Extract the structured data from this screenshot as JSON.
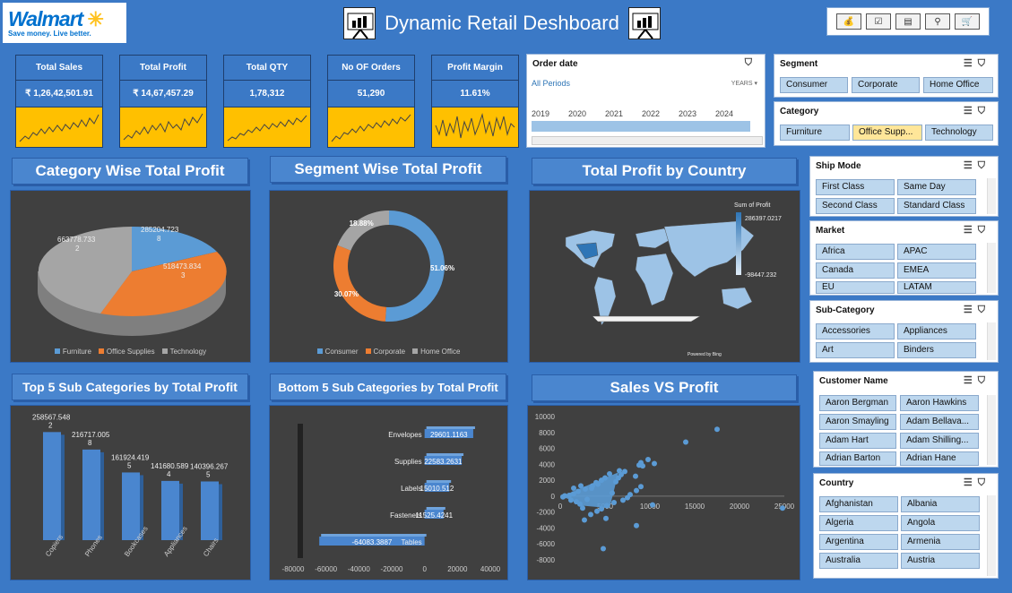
{
  "header": {
    "logo_name": "Walmart",
    "logo_tagline": "Save money. Live better.",
    "title": "Dynamic Retail Deshboard"
  },
  "colors": {
    "background": "#3b79c6",
    "kpi_spark": "#ffc000",
    "furniture": "#5b9bd5",
    "office": "#ed7d31",
    "technology": "#a5a5a5"
  },
  "kpis": [
    {
      "label": "Total Sales",
      "value": "₹ 1,26,42,501.91"
    },
    {
      "label": "Total Profit",
      "value": "₹ 14,67,457.29"
    },
    {
      "label": "Total QTY",
      "value": "1,78,312"
    },
    {
      "label": "No OF Orders",
      "value": "51,290"
    },
    {
      "label": "Profit Margin",
      "value": "11.61%"
    }
  ],
  "order_date": {
    "title": "Order date",
    "period": "All Periods",
    "unit": "YEARS",
    "years": [
      "2019",
      "2020",
      "2021",
      "2022",
      "2023",
      "2024"
    ]
  },
  "segment_slicer": {
    "title": "Segment",
    "items": [
      "Consumer",
      "Corporate",
      "Home Office"
    ]
  },
  "category_slicer": {
    "title": "Category",
    "items": [
      "Furniture",
      "Office Supp...",
      "Technology"
    ]
  },
  "shipmode_slicer": {
    "title": "Ship Mode",
    "items": [
      "First Class",
      "Same Day",
      "Second Class",
      "Standard Class"
    ]
  },
  "market_slicer": {
    "title": "Market",
    "items": [
      "Africa",
      "APAC",
      "Canada",
      "EMEA",
      "EU",
      "LATAM"
    ]
  },
  "subcat_slicer": {
    "title": "Sub-Category",
    "items": [
      "Accessories",
      "Appliances",
      "Art",
      "Binders"
    ]
  },
  "customer_slicer": {
    "title": "Customer Name",
    "items": [
      "Aaron Bergman",
      "Aaron Hawkins",
      "Aaron Smayling",
      "Adam Bellava...",
      "Adam Hart",
      "Adam Shilling...",
      "Adrian Barton",
      "Adrian Hane"
    ]
  },
  "country_slicer": {
    "title": "Country",
    "items": [
      "Afghanistan",
      "Albania",
      "Algeria",
      "Angola",
      "Argentina",
      "Armenia",
      "Australia",
      "Austria"
    ]
  },
  "panels": {
    "category": "Category Wise Total Profit",
    "segment": "Segment Wise Total Profit",
    "country": "Total Profit by Country",
    "top5": "Top 5 Sub Categories by Total Profit",
    "bottom5": "Bottom 5 Sub Categories by Total Profit",
    "sales_profit": "Sales VS Profit"
  },
  "map": {
    "legend_title": "Sum of Profit",
    "max": "286397.0217",
    "min": "-98447.232",
    "credit": "Powered by Bing"
  },
  "chart_data": [
    {
      "type": "pie",
      "title": "Category Wise Total Profit",
      "labels": [
        "Furniture",
        "Office Supplies",
        "Technology"
      ],
      "values": [
        285204.7238,
        518473.8343,
        663778.7332
      ]
    },
    {
      "type": "pie",
      "title": "Segment Wise Total Profit",
      "labels": [
        "Consumer",
        "Corporate",
        "Home Office"
      ],
      "values": [
        51.06,
        30.07,
        18.88
      ]
    },
    {
      "type": "bar",
      "title": "Top 5 Sub Categories by Total Profit",
      "categories": [
        "Copiers",
        "Phones",
        "Bookcases",
        "Appliances",
        "Chairs"
      ],
      "values": [
        258567.5482,
        216717.0058,
        161924.4195,
        141680.5894,
        140396.2675
      ]
    },
    {
      "type": "bar",
      "title": "Bottom 5 Sub Categories by Total Profit",
      "categories": [
        "Envelopes",
        "Supplies",
        "Labels",
        "Fasteners",
        "Tables"
      ],
      "values": [
        29601.1163,
        22583.2631,
        15010.512,
        11525.4241,
        -64083.3887
      ],
      "xlim": [
        -80000,
        40000
      ],
      "xticks": [
        "-80000",
        "-60000",
        "-40000",
        "-20000",
        "0",
        "20000",
        "40000"
      ]
    },
    {
      "type": "scatter",
      "title": "Sales VS Profit",
      "xlim": [
        0,
        25000
      ],
      "ylim": [
        -8000,
        10000
      ],
      "xticks": [
        "0",
        "5000",
        "10000",
        "15000",
        "20000",
        "25000"
      ],
      "yticks": [
        "10000",
        "8000",
        "6000",
        "4000",
        "2000",
        "0",
        "-2000",
        "-4000",
        "-6000",
        "-8000"
      ],
      "points": [
        [
          17500,
          8400
        ],
        [
          14000,
          6800
        ],
        [
          9800,
          4600
        ],
        [
          10500,
          4100
        ],
        [
          9200,
          3800
        ],
        [
          9000,
          4200
        ],
        [
          8800,
          3900
        ],
        [
          7200,
          3100
        ],
        [
          6800,
          2700
        ],
        [
          6500,
          2300
        ],
        [
          8400,
          2500
        ],
        [
          9000,
          1200
        ],
        [
          8500,
          700
        ],
        [
          7800,
          200
        ],
        [
          7500,
          -200
        ],
        [
          7000,
          -500
        ],
        [
          6000,
          -800
        ],
        [
          5200,
          -1200
        ],
        [
          4600,
          -1600
        ],
        [
          4100,
          -1900
        ],
        [
          3400,
          -2300
        ],
        [
          2700,
          -3000
        ],
        [
          2200,
          -1000
        ],
        [
          3000,
          -400
        ],
        [
          4000,
          1700
        ],
        [
          4600,
          2000
        ],
        [
          5000,
          2300
        ],
        [
          5500,
          2800
        ],
        [
          6600,
          3200
        ],
        [
          3600,
          1300
        ],
        [
          2800,
          900
        ],
        [
          2000,
          600
        ],
        [
          1500,
          300
        ],
        [
          1000,
          100
        ],
        [
          500,
          50
        ],
        [
          300,
          -100
        ],
        [
          1200,
          -500
        ],
        [
          1800,
          -700
        ],
        [
          2500,
          -1500
        ],
        [
          5100,
          -2800
        ],
        [
          8500,
          -3700
        ],
        [
          24800,
          -1500
        ],
        [
          10300,
          -1100
        ],
        [
          4800,
          -6600
        ],
        [
          3500,
          1000
        ],
        [
          4200,
          1500
        ],
        [
          6200,
          1800
        ],
        [
          5800,
          400
        ],
        [
          1500,
          1000
        ],
        [
          2300,
          1300
        ]
      ]
    }
  ]
}
